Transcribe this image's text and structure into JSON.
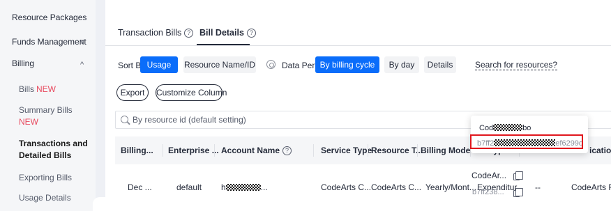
{
  "sidebar": {
    "items": [
      {
        "label": "Resource Packages"
      },
      {
        "label": "Funds Management",
        "chevron": "v"
      },
      {
        "label": "Billing",
        "chevron": "^"
      },
      {
        "label": "Bills",
        "badge": "NEW"
      },
      {
        "label": "Summary Bills",
        "badge": "NEW"
      },
      {
        "label": "Transactions and",
        "label2": "Detailed Bills"
      },
      {
        "label": "Exporting Bills"
      },
      {
        "label": "Usage Details"
      }
    ]
  },
  "tabs": [
    {
      "label": "Transaction Bills",
      "help": "?"
    },
    {
      "label": "Bill Details",
      "help": "?"
    }
  ],
  "filters": {
    "sort_by_label": "Sort By",
    "sort_options": [
      "Usage",
      "Resource Name/ID"
    ],
    "data_period_label": "Data Period",
    "period_options": [
      "By billing cycle",
      "By day",
      "Details"
    ],
    "search_link": "Search for resources?"
  },
  "actions": {
    "export": "Export",
    "customize_column": "Customize Column"
  },
  "search": {
    "placeholder": "By resource id (default setting)"
  },
  "table": {
    "headers": [
      "Billing...",
      "Enterprise ...",
      "Account Name",
      "Service Type",
      "Resource T...",
      "Billing Mode",
      "Bill Type",
      "icatio..."
    ],
    "account_help": "?",
    "row": {
      "billing": "Dec ...",
      "enterprise": "default",
      "account_prefix": "h",
      "account_suffix": "...",
      "service_type": "CodeArts C...",
      "resource_type": "CodeArts C...",
      "billing_mode": "Yearly/Mont...",
      "bill_type": "Expenditur...",
      "resource_name": "CodeAr...",
      "resource_id": "b7ff238...",
      "dash": "--",
      "application": "CodeArts F..."
    }
  },
  "tooltip": {
    "line1_prefix": "Cod",
    "line1_suffix": "bo",
    "line2_prefix": "b7ff2",
    "line2_suffix": "ef6299d"
  },
  "colors": {
    "accent": "#0a6dfa",
    "new_badge": "#e84a5f",
    "highlight": "#e0161d"
  }
}
